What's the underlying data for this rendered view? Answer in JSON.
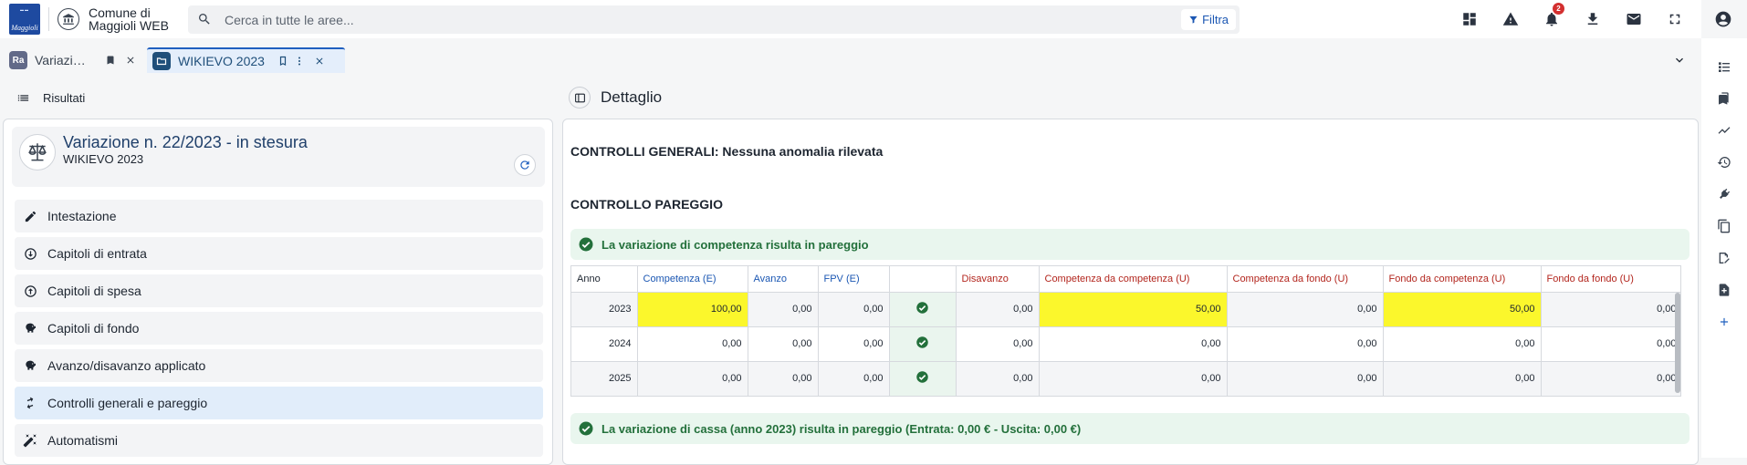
{
  "app": {
    "logo_text": "Maggioli",
    "org_name_line1": "Comune di",
    "org_name_line2": "Maggioli WEB",
    "search_placeholder": "Cerca in tutte le aree...",
    "filter_label": "Filtra",
    "notification_count": "2"
  },
  "tabs": [
    {
      "icon_text": "Ra",
      "label": "Variazi…"
    },
    {
      "label": "WIKIEVO 2023"
    }
  ],
  "left_panel": {
    "header_label": "Risultati",
    "card": {
      "title": "Variazione n. 22/2023 - in stesura",
      "subtitle": "WIKIEVO 2023"
    },
    "menu": [
      {
        "label": "Intestazione",
        "icon": "pencil-icon"
      },
      {
        "label": "Capitoli di entrata",
        "icon": "arrow-circle-down-icon"
      },
      {
        "label": "Capitoli di spesa",
        "icon": "arrow-circle-up-icon"
      },
      {
        "label": "Capitoli di fondo",
        "icon": "piggy-bank-icon"
      },
      {
        "label": "Avanzo/disavanzo applicato",
        "icon": "piggy-bank-icon"
      },
      {
        "label": "Controlli generali e pareggio",
        "icon": "balance-arrows-icon",
        "active": true
      },
      {
        "label": "Automatismi",
        "icon": "magic-wand-icon"
      }
    ]
  },
  "detail": {
    "header_title": "Dettaglio",
    "general_check": "CONTROLLI GENERALI: Nessuna anomalia rilevata",
    "balance_title": "CONTROLLO PAREGGIO",
    "competenza_msg": "La variazione di competenza risulta in pareggio",
    "cassa_msg": "La variazione di cassa (anno 2023) risulta in pareggio (Entrata: 0,00 € - Uscita: 0,00 €)",
    "table": {
      "headers": {
        "anno": "Anno",
        "comp_e": "Competenza (E)",
        "avanzo": "Avanzo",
        "fpv_e": "FPV (E)",
        "check": "",
        "disavanzo": "Disavanzo",
        "comp_da_comp": "Competenza da competenza (U)",
        "comp_da_fondo": "Competenza da fondo (U)",
        "fondo_da_comp": "Fondo da competenza (U)",
        "fondo_da_fondo": "Fondo da fondo (U)"
      },
      "rows": [
        {
          "anno": "2023",
          "comp_e": "100,00",
          "avanzo": "0,00",
          "fpv_e": "0,00",
          "disavanzo": "0,00",
          "comp_da_comp": "50,00",
          "comp_da_fondo": "0,00",
          "fondo_da_comp": "50,00",
          "fondo_da_fondo": "0,00"
        },
        {
          "anno": "2024",
          "comp_e": "0,00",
          "avanzo": "0,00",
          "fpv_e": "0,00",
          "disavanzo": "0,00",
          "comp_da_comp": "0,00",
          "comp_da_fondo": "0,00",
          "fondo_da_comp": "0,00",
          "fondo_da_fondo": "0,00"
        },
        {
          "anno": "2025",
          "comp_e": "0,00",
          "avanzo": "0,00",
          "fpv_e": "0,00",
          "disavanzo": "0,00",
          "comp_da_comp": "0,00",
          "comp_da_fondo": "0,00",
          "fondo_da_comp": "0,00",
          "fondo_da_fondo": "0,00"
        }
      ]
    }
  },
  "colors": {
    "accent": "#1f5fbf",
    "success": "#23703b",
    "success_bg": "#e9f6ee",
    "highlight": "#fbf72c",
    "header_red": "#b3261e",
    "header_blue": "#1b57b3"
  }
}
